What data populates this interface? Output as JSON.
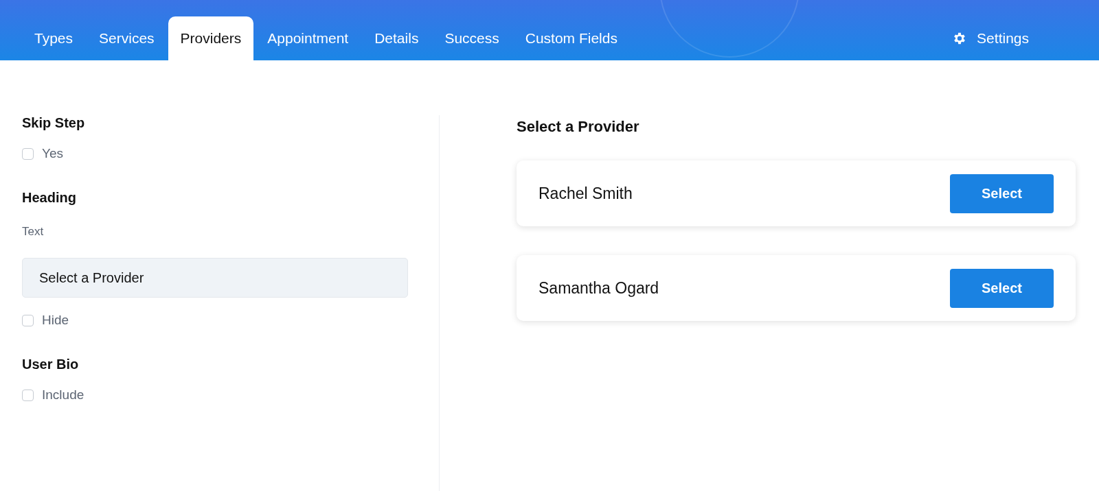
{
  "tabs": [
    {
      "label": "Types",
      "selected": false
    },
    {
      "label": "Services",
      "selected": false
    },
    {
      "label": "Providers",
      "selected": true
    },
    {
      "label": "Appointment",
      "selected": false
    },
    {
      "label": "Details",
      "selected": false
    },
    {
      "label": "Success",
      "selected": false
    },
    {
      "label": "Custom Fields",
      "selected": false
    }
  ],
  "settings_link": {
    "label": "Settings"
  },
  "sections": [
    {
      "title": "Skip Step",
      "fields": [
        {
          "kind": "checkbox",
          "label": "Yes",
          "checked": false
        }
      ]
    },
    {
      "title": "Heading",
      "fields": [
        {
          "kind": "text",
          "label": "Text",
          "value": "Select a Provider"
        },
        {
          "kind": "checkbox",
          "label": "Hide",
          "checked": false
        }
      ]
    },
    {
      "title": "User Bio",
      "fields": [
        {
          "kind": "checkbox",
          "label": "Include",
          "checked": false
        }
      ]
    }
  ],
  "preview": {
    "title": "Select a Provider",
    "providers": [
      {
        "name": "Rachel Smith",
        "button": "Select"
      },
      {
        "name": "Samantha Ogard",
        "button": "Select"
      }
    ]
  }
}
